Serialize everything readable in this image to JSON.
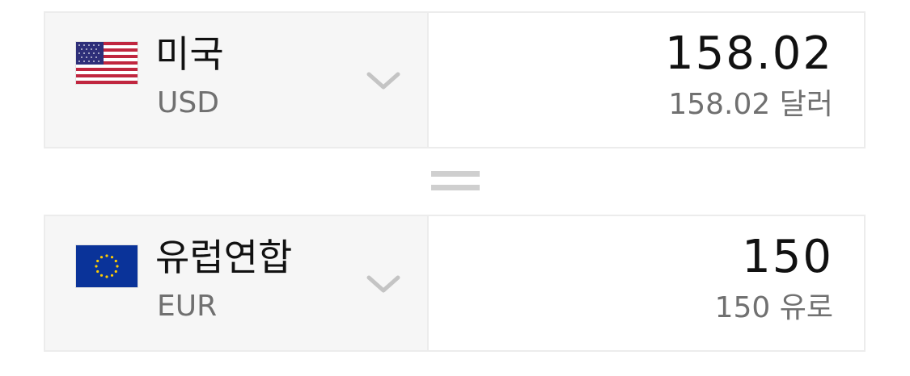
{
  "from": {
    "country": "미국",
    "code": "USD",
    "flag_icon": "us-flag-icon",
    "amount": "158.02",
    "amount_text": "158.02 달러"
  },
  "to": {
    "country": "유럽연합",
    "code": "EUR",
    "flag_icon": "eu-flag-icon",
    "amount": "150",
    "amount_text": "150 유로"
  },
  "colors": {
    "panel_bg": "#f6f6f6",
    "border": "#ececec",
    "primary_text": "#111111",
    "secondary_text": "#707070",
    "equals_sign": "#cfcfcf",
    "us_red": "#c0263f",
    "us_blue": "#2e2f79",
    "eu_blue": "#0a3399",
    "eu_gold": "#ffcc00"
  }
}
